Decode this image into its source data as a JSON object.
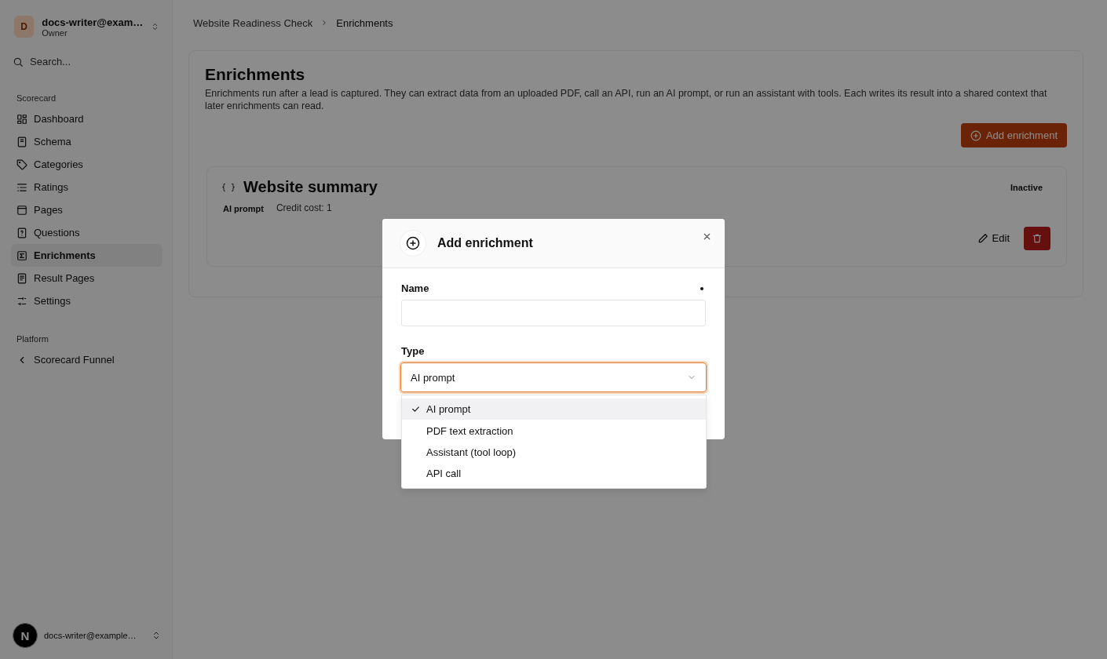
{
  "sidebar": {
    "account": {
      "avatar": "D",
      "name": "docs-writer@exam…",
      "role": "Owner"
    },
    "search": {
      "placeholder": "Search..."
    },
    "sections": [
      {
        "title": "Scorecard",
        "items": [
          {
            "label": "Dashboard",
            "selected": false
          },
          {
            "label": "Schema",
            "selected": false
          },
          {
            "label": "Categories",
            "selected": false
          },
          {
            "label": "Ratings",
            "selected": false
          },
          {
            "label": "Pages",
            "selected": false
          },
          {
            "label": "Questions",
            "selected": false
          },
          {
            "label": "Enrichments",
            "selected": true
          },
          {
            "label": "Result Pages",
            "selected": false
          },
          {
            "label": "Settings",
            "selected": false
          }
        ]
      },
      {
        "title": "Platform",
        "items": [
          {
            "label": "Scorecard Funnel",
            "selected": false
          }
        ]
      }
    ],
    "user": {
      "logo": "N",
      "name": "docs-writer@example…"
    }
  },
  "breadcrumb": [
    {
      "label": "Website Readiness Check",
      "current": false
    },
    {
      "label": "Enrichments",
      "current": true
    }
  ],
  "page": {
    "title": "Enrichments",
    "description": "Enrichments run after a lead is captured. They can extract data from an uploaded PDF, call an API, run an AI prompt, or run an assistant with tools. Each writes its result into a shared context that later enrichments can read.",
    "add_button": "Add enrichment"
  },
  "enrichments": [
    {
      "icon_text": "{ }",
      "name": "Website summary",
      "type": "AI prompt",
      "credit": "Credit cost: 1",
      "status": "Inactive",
      "edit": "Edit"
    }
  ],
  "modal": {
    "title": "Add enrichment",
    "fields": [
      {
        "kind": "text",
        "label": "Name",
        "required": true
      },
      {
        "kind": "select",
        "label": "Type",
        "value": "AI prompt",
        "expanded": true,
        "options": [
          {
            "label": "AI prompt",
            "selected": true
          },
          {
            "label": "PDF text extraction",
            "selected": false
          },
          {
            "label": "Assistant (tool loop)",
            "selected": false
          },
          {
            "label": "API call",
            "selected": false
          }
        ]
      }
    ]
  }
}
